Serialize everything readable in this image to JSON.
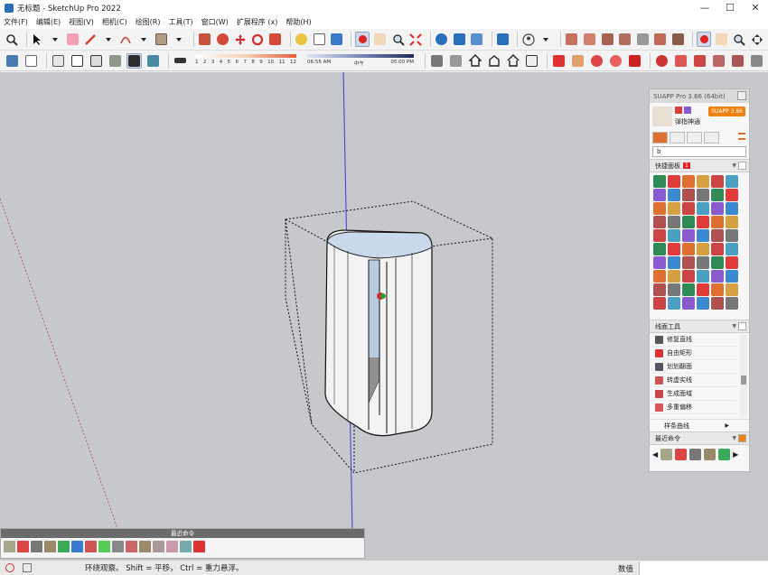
{
  "window": {
    "title": "无标题 - SketchUp Pro 2022",
    "controls": [
      "—",
      "☐",
      "✕"
    ]
  },
  "menu": [
    "文件(F)",
    "编辑(E)",
    "视图(V)",
    "相机(C)",
    "绘图(R)",
    "工具(T)",
    "窗口(W)",
    "扩展程序 (x)",
    "帮助(H)"
  ],
  "toolbar": {
    "shadow_ticks": [
      "1",
      "2",
      "3",
      "4",
      "5",
      "6",
      "7",
      "8",
      "9",
      "10",
      "11",
      "12"
    ],
    "time_start": "06:55 AM",
    "time_mid": "中午",
    "time_end": "05:00 PM"
  },
  "suapp": {
    "title": "SUAPP Pro 3.86 (64bit)",
    "user": "弹指神通",
    "button": "SUAPP 3.86",
    "search_value": "b",
    "quick_panel": "快捷面板",
    "quick_badge": "1",
    "line_tools": "线面工具",
    "line_items": [
      "修复直线",
      "自由矩形",
      "划划翻面",
      "转虚实线",
      "生成面域",
      "多重偏移"
    ],
    "spline": "样条曲线",
    "recent": "最近命令"
  },
  "bottom_bar": {
    "title": "最近命令"
  },
  "status": {
    "message": "环绕观察。 Shift = 平移， Ctrl = 重力悬浮。",
    "measure_label": "数值",
    "measure_value": ""
  },
  "colors": {
    "axis_blue": "#3b3bd6",
    "axis_red": "#c04040",
    "accent": "#f08010",
    "viewport": "#c7c8cc"
  }
}
